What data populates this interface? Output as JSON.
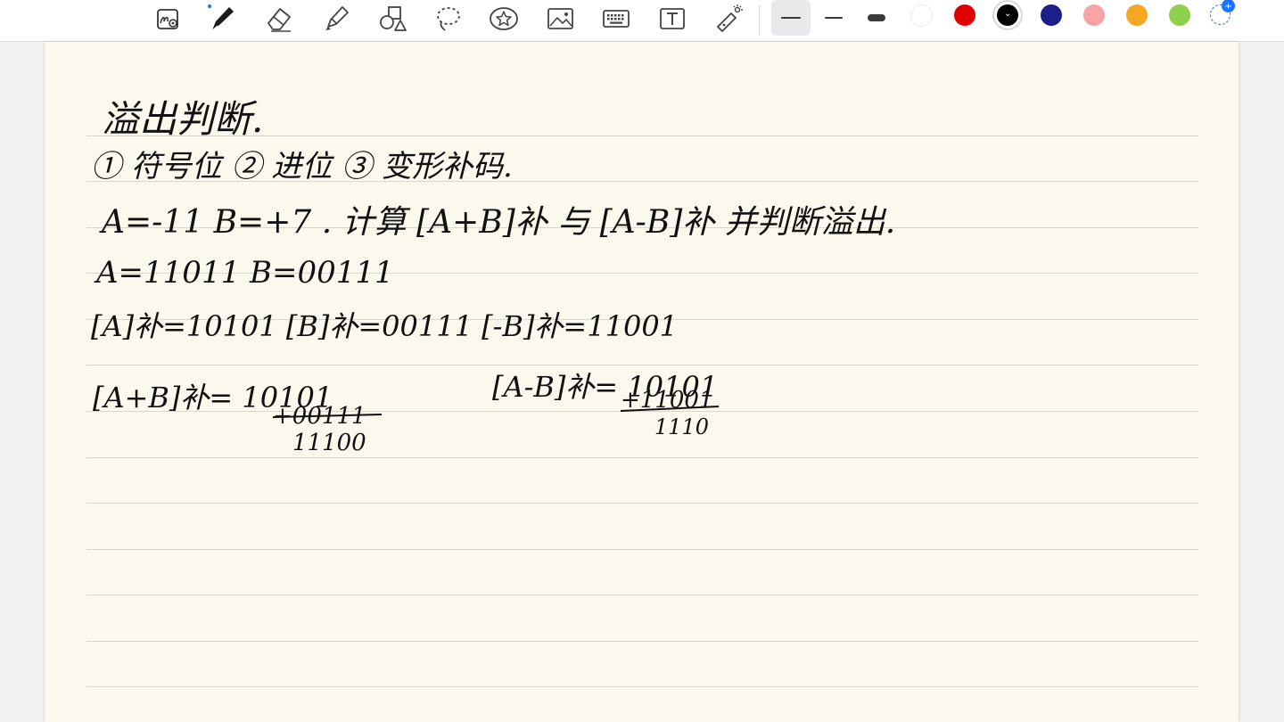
{
  "toolbar": {
    "tools": [
      {
        "name": "handwriting-convert-tool",
        "icon": "handwriting-zoom-icon"
      },
      {
        "name": "pen-tool",
        "icon": "fountain-pen-icon"
      },
      {
        "name": "eraser-tool",
        "icon": "eraser-icon"
      },
      {
        "name": "highlighter-tool",
        "icon": "highlighter-icon"
      },
      {
        "name": "shapes-tool",
        "icon": "shapes-icon"
      },
      {
        "name": "lasso-tool",
        "icon": "lasso-icon"
      },
      {
        "name": "sticker-tool",
        "icon": "star-sticker-icon"
      },
      {
        "name": "image-tool",
        "icon": "image-icon"
      },
      {
        "name": "keyboard-tool",
        "icon": "keyboard-icon"
      },
      {
        "name": "text-box-tool",
        "icon": "text-box-icon"
      },
      {
        "name": "laser-pointer-tool",
        "icon": "laser-pointer-icon"
      }
    ],
    "stroke_widths": [
      "thin",
      "medium",
      "thick"
    ],
    "selected_stroke": "thin",
    "colors": [
      "#ffffff",
      "#e00000",
      "#000000",
      "#1c1f8a",
      "#f7a3a8",
      "#f5a623",
      "#8fd14f"
    ],
    "selected_color": "#000000",
    "accent": "#1a73ff"
  },
  "note": {
    "background": "#fbf8ee",
    "line_color": "#d9d6cd",
    "handwriting": [
      "溢出判断.",
      "① 符号位 ② 进位 ③ 变形补码.",
      "A=-11   B=+7 .   计算 [A+B]补 与 [A-B]补 并判断溢出.",
      "A=11011   B=00111",
      "[A]补=10101   [B]补=00111   [-B]补=11001",
      "[A+B]补= 10101",
      "+00111",
      "11100",
      "[A-B]补= 10101",
      "+11001",
      "1110"
    ]
  }
}
